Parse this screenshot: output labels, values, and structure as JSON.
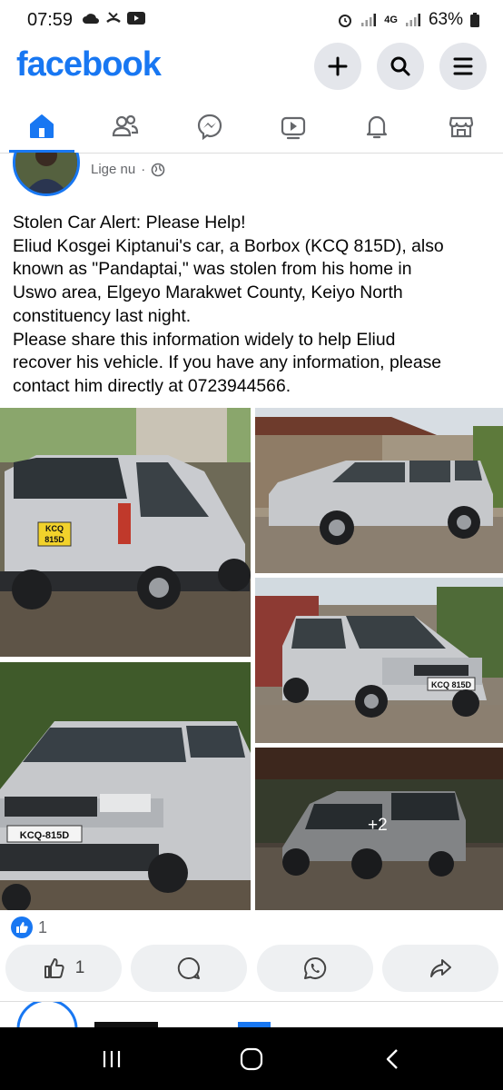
{
  "status_bar": {
    "time": "07:59",
    "battery": "63%",
    "network": "4G"
  },
  "header": {
    "logo": "facebook",
    "brand_color": "#1877f2",
    "buttons": [
      "plus-icon",
      "search-icon",
      "menu-icon"
    ]
  },
  "nav": {
    "active_tab": "home",
    "tabs": [
      "home-icon",
      "friends-icon",
      "messenger-icon",
      "video-icon",
      "bell-icon",
      "marketplace-icon"
    ]
  },
  "post": {
    "time": "Lige nu",
    "separator": "·",
    "lines": [
      "Stolen Car Alert: Please Help!",
      "Eliud Kosgei Kiptanui's car, a Borbox (KCQ 815D), also",
      "known as \"Pandaptai,\" was stolen from his home in",
      "Uswo area, Elgeyo Marakwet County, Keiyo North",
      "constituency last night.",
      "Please share this information widely to help Eliud",
      "recover his vehicle. If you have any information, please",
      "contact him directly at 0723944566."
    ],
    "photos": {
      "plates": [
        "KCQ 815D",
        "KCQ 815D",
        "KCQ-815D"
      ],
      "more_count": "+2"
    },
    "reaction_count": "1",
    "like_count": "1"
  }
}
